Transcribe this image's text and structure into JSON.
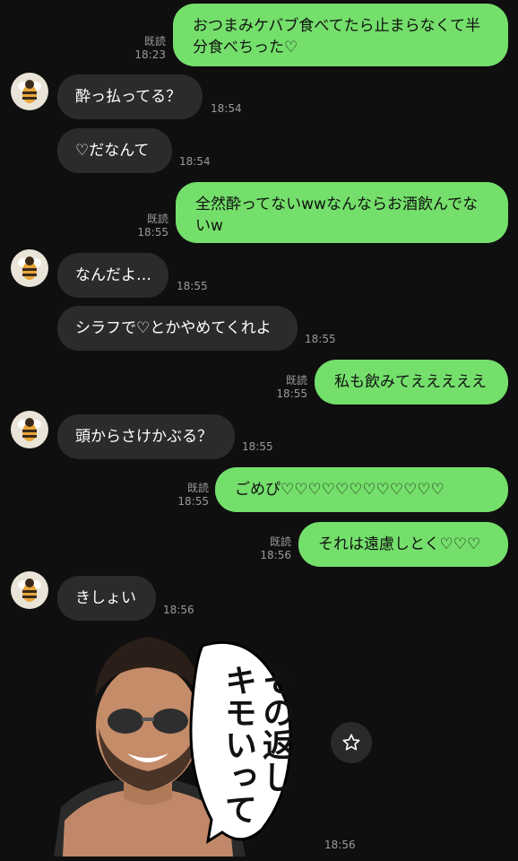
{
  "messages": [
    {
      "id": "m1",
      "side": "out",
      "text": "おつまみケバブ食べてたら止まらなくて半分食べちった♡",
      "read": "既読",
      "time": "18:23"
    },
    {
      "id": "m2",
      "side": "in",
      "text": "酔っ払ってる？",
      "time": "18:54"
    },
    {
      "id": "m3",
      "side": "in",
      "text": "♡だなんて",
      "time": "18:54"
    },
    {
      "id": "m4",
      "side": "out",
      "text": "全然酔ってないwwなんならお酒飲んでないw",
      "read": "既読",
      "time": "18:55"
    },
    {
      "id": "m5",
      "side": "in",
      "text": "なんだよ…",
      "time": "18:55"
    },
    {
      "id": "m6",
      "side": "in",
      "text": "シラフで♡とかやめてくれよ",
      "time": "18:55"
    },
    {
      "id": "m7",
      "side": "out",
      "text": "私も飲みてえええええ",
      "read": "既読",
      "time": "18:55"
    },
    {
      "id": "m8",
      "side": "in",
      "text": "頭からさけかぶる？",
      "time": "18:55"
    },
    {
      "id": "m9",
      "side": "out",
      "text": "ごめぴ♡♡♡♡♡♡♡♡♡♡♡♡",
      "read": "既読",
      "time": "18:55"
    },
    {
      "id": "m10",
      "side": "out",
      "text": "それは遠慮しとく♡♡♡",
      "read": "既読",
      "time": "18:56"
    },
    {
      "id": "m11",
      "side": "in",
      "text": "きしょい",
      "time": "18:56"
    }
  ],
  "sticker": {
    "speech_lines": [
      "その返し",
      "キモいって"
    ],
    "time": "18:56",
    "action_icon": "star-icon"
  },
  "avatar_icon": "bee-icon",
  "colors": {
    "background": "#0f0f0f",
    "incoming_bubble": "#2b2b2b",
    "outgoing_bubble": "#74df6b",
    "meta_text": "#9a9a9a"
  }
}
